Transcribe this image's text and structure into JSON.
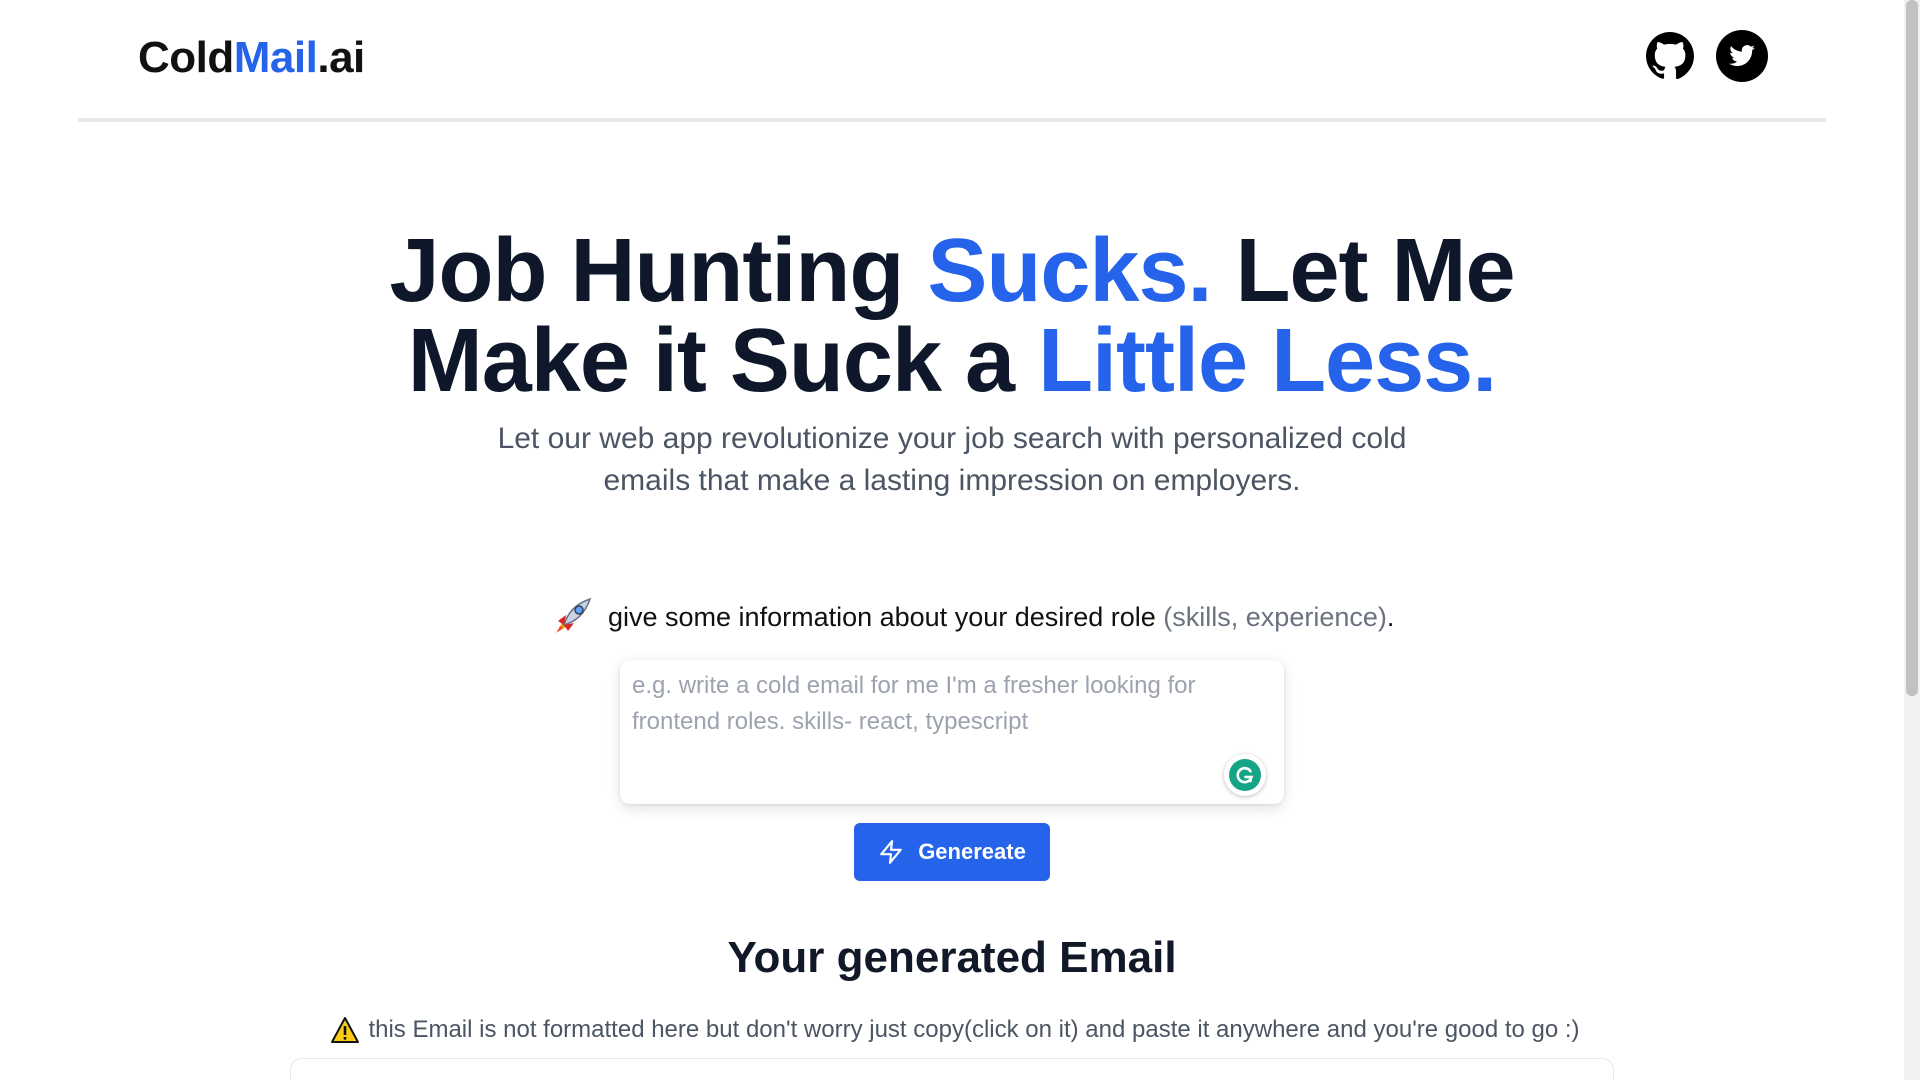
{
  "header": {
    "logo_part1": "Cold",
    "logo_part2": "Mail",
    "logo_part3": ".ai",
    "github_icon": "github-icon",
    "twitter_icon": "twitter-icon"
  },
  "hero": {
    "line1_a": "Job Hunting ",
    "line1_b": "Sucks.",
    "line1_c": " Let Me",
    "line2_a": "Make it Suck a ",
    "line2_b": "Little Less.",
    "subtitle": "Let our web app revolutionize your job search with personalized cold emails that make a lasting impression on employers."
  },
  "prompt": {
    "label": "give some information about your desired role ",
    "label_muted": "(skills, experience)",
    "label_end": ".",
    "placeholder": "e.g. write a cold email for me I'm a fresher looking for frontend roles. skills- react, typescript",
    "value": ""
  },
  "generate": {
    "label": "Genereate"
  },
  "result": {
    "title": "Your generated Email",
    "warning": "this Email is not formatted here but don't worry just copy(click on it) and paste it anywhere and you're good to go :)"
  },
  "colors": {
    "accent": "#2563eb",
    "heading": "#0f172a",
    "muted": "#4b5563"
  }
}
